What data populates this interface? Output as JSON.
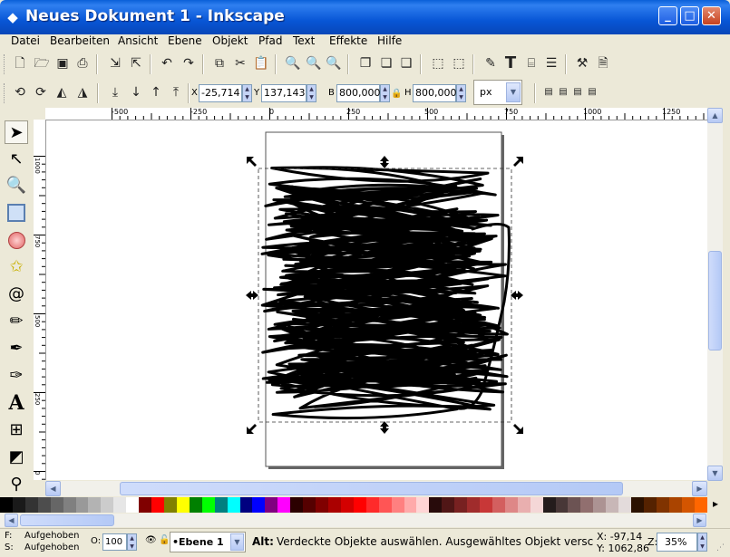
{
  "window": {
    "title": "Neues Dokument 1 - Inkscape",
    "minimize": "_",
    "maximize": "□",
    "close": "✕"
  },
  "menu": [
    "Datei",
    "Bearbeiten",
    "Ansicht",
    "Ebene",
    "Objekt",
    "Pfad",
    "Text",
    "Effekte",
    "Hilfe"
  ],
  "commands_toolbar": [
    "new-doc-icon",
    "open-icon",
    "save-icon",
    "print-icon",
    "import-icon",
    "export-icon",
    "undo-icon",
    "redo-icon",
    "copy-icon",
    "cut-icon",
    "paste-icon",
    "zoom-selection-icon",
    "zoom-drawing-icon",
    "zoom-page-icon",
    "duplicate-icon",
    "clone-icon",
    "unlink-clone-icon",
    "group-icon",
    "ungroup-icon",
    "fill-stroke-icon",
    "text-font-icon",
    "xml-editor-icon",
    "align-distribute-icon",
    "preferences-icon",
    "document-properties-icon"
  ],
  "select_toolbar": {
    "x_label": "X",
    "x_value": "-25,714",
    "y_label": "Y",
    "y_value": "137,143",
    "b_label": "B",
    "b_value": "800,000",
    "h_label": "H",
    "h_value": "800,000",
    "unit": "px"
  },
  "ruler": {
    "h_labels": [
      "-500",
      "-250",
      "0",
      "250",
      "500",
      "750",
      "1000",
      "1250"
    ],
    "v_labels": [
      "1000",
      "750",
      "500",
      "250",
      "0"
    ]
  },
  "tools": [
    "selector-tool-icon",
    "node-tool-icon",
    "zoom-tool-icon",
    "rectangle-tool-icon",
    "ellipse-tool-icon",
    "star-tool-icon",
    "spiral-tool-icon",
    "pencil-tool-icon",
    "pen-tool-icon",
    "calligraphy-tool-icon",
    "text-tool-icon",
    "connector-tool-icon",
    "gradient-tool-icon",
    "dropper-tool-icon"
  ],
  "palette": [
    "#000000",
    "#1a1a1a",
    "#333333",
    "#4d4d4d",
    "#666666",
    "#808080",
    "#999999",
    "#b3b3b3",
    "#cccccc",
    "#e6e6e6",
    "#ffffff",
    "#800000",
    "#ff0000",
    "#808000",
    "#ffff00",
    "#008000",
    "#00ff00",
    "#008080",
    "#00ffff",
    "#000080",
    "#0000ff",
    "#800080",
    "#ff00ff",
    "#2b0000",
    "#550000",
    "#800000",
    "#aa0000",
    "#d40000",
    "#ff0000",
    "#ff2a2a",
    "#ff5555",
    "#ff8080",
    "#ffaaaa",
    "#ffd5d5",
    "#280b0b",
    "#501616",
    "#782121",
    "#a02c2c",
    "#c83737",
    "#d35f5f",
    "#de8787",
    "#e9afaf",
    "#f4d7d7",
    "#241c1c",
    "#483737",
    "#6c5353",
    "#916f6f",
    "#ac9393",
    "#c8b7b7",
    "#e3dbdb",
    "#2b1100",
    "#552200",
    "#803300",
    "#aa4400",
    "#d45500",
    "#ff6600"
  ],
  "status": {
    "fill_label": "F:",
    "fill_value": "Aufgehoben",
    "stroke_label": "S:",
    "stroke_value": "Aufgehoben",
    "opacity_label": "O:",
    "opacity_value": "100",
    "layer": "•Ebene 1",
    "message_bold": "Alt:",
    "message": "Verdeckte Objekte auswählen. Ausgewähltes Objekt verschie",
    "cursor_x": "X: -97,14",
    "cursor_y": "Y: 1062,86",
    "zoom_label": "Z:",
    "zoom_value": "35%"
  }
}
